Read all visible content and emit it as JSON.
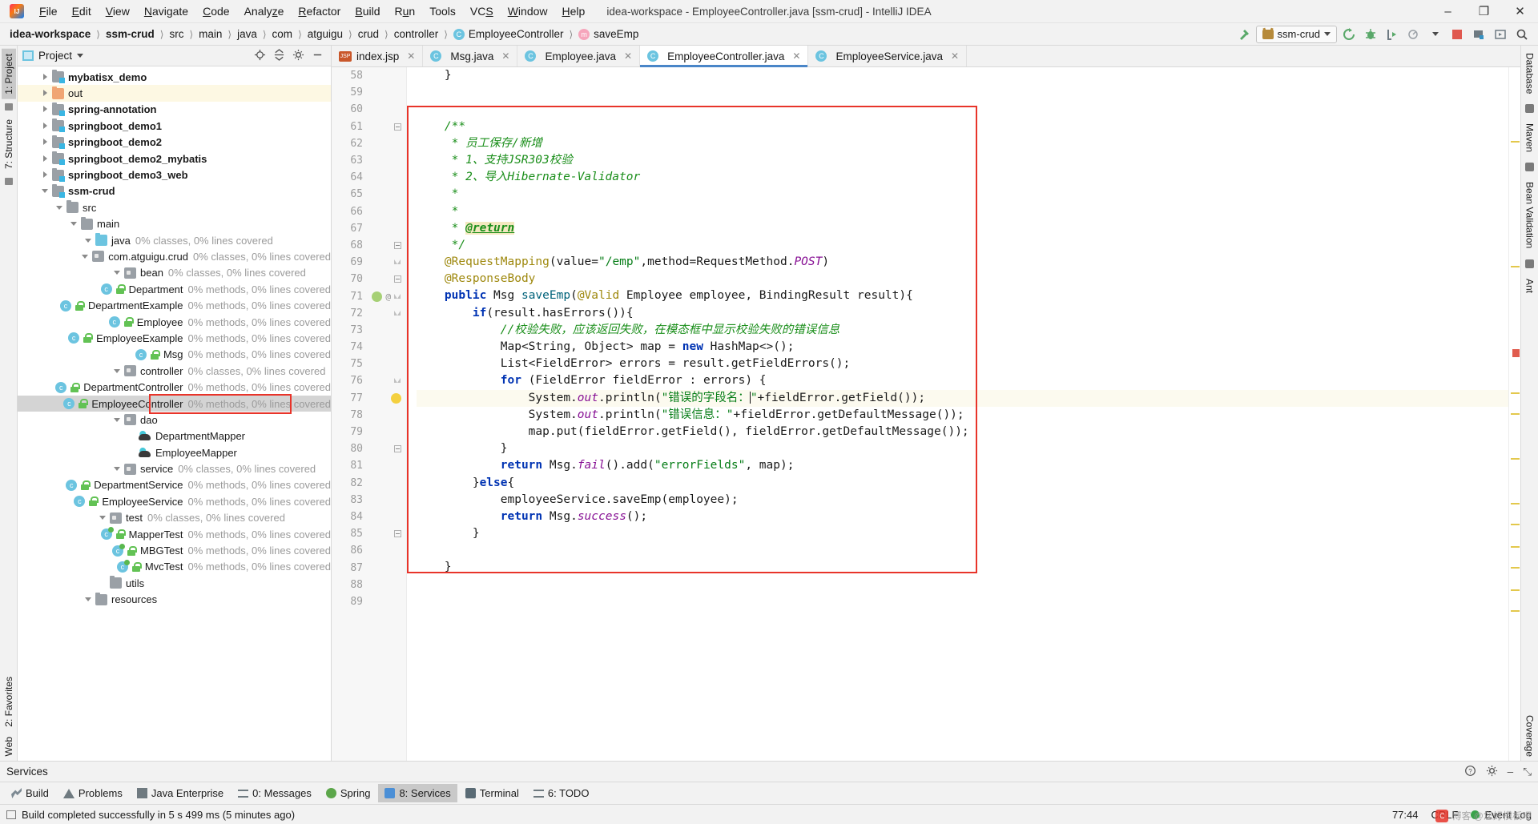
{
  "window": {
    "title": "idea-workspace - EmployeeController.java [ssm-crud] - IntelliJ IDEA",
    "minimize": "–",
    "maximize": "❐",
    "close": "✕"
  },
  "menu": {
    "items": [
      "File",
      "Edit",
      "View",
      "Navigate",
      "Code",
      "Analyze",
      "Refactor",
      "Build",
      "Run",
      "Tools",
      "VCS",
      "Window",
      "Help"
    ]
  },
  "breadcrumb": {
    "items": [
      {
        "label": "idea-workspace",
        "bold": true,
        "icon": ""
      },
      {
        "label": "ssm-crud",
        "bold": true,
        "icon": ""
      },
      {
        "label": "src",
        "bold": false,
        "icon": ""
      },
      {
        "label": "main",
        "bold": false,
        "icon": ""
      },
      {
        "label": "java",
        "bold": false,
        "icon": ""
      },
      {
        "label": "com",
        "bold": false,
        "icon": ""
      },
      {
        "label": "atguigu",
        "bold": false,
        "icon": ""
      },
      {
        "label": "crud",
        "bold": false,
        "icon": ""
      },
      {
        "label": "controller",
        "bold": false,
        "icon": ""
      },
      {
        "label": "EmployeeController",
        "bold": false,
        "icon": "class-badge"
      },
      {
        "label": "saveEmp",
        "bold": false,
        "icon": "method-badge"
      }
    ],
    "separator": "〉"
  },
  "toolbar": {
    "run_config": "ssm-crud",
    "icons": [
      "build-hammer-icon",
      "rerun-icon",
      "debug-icon",
      "run-with-coverage-icon",
      "profiler-icon",
      "stop-icon",
      "open-project-structure-icon",
      "select-in-icon",
      "search-everywhere-icon"
    ]
  },
  "left_rail": {
    "tabs": [
      {
        "label": "1: Project",
        "active": true
      },
      {
        "label": "7: Structure",
        "active": false
      }
    ],
    "bottom_tabs": [
      {
        "label": "2: Favorites",
        "active": false
      },
      {
        "label": "Web",
        "active": false
      }
    ]
  },
  "right_rail": {
    "tabs": [
      "Database",
      "Maven",
      "Bean Validation",
      "Ant",
      "Coverage"
    ]
  },
  "project_panel": {
    "title": "Project",
    "dropdown_caret": "▾",
    "header_icons": [
      "locate-icon",
      "collapse-all-icon",
      "settings-icon",
      "hide-icon"
    ],
    "tree": [
      {
        "depth": 1,
        "arrow": "closed",
        "icon": "module-folder",
        "label": "mybatisx_demo",
        "bold": true,
        "coverage": "",
        "state": ""
      },
      {
        "depth": 1,
        "arrow": "closed",
        "icon": "orange-folder",
        "label": "out",
        "bold": false,
        "coverage": "",
        "state": "hl-yellow"
      },
      {
        "depth": 1,
        "arrow": "closed",
        "icon": "module-folder",
        "label": "spring-annotation",
        "bold": true,
        "coverage": "",
        "state": ""
      },
      {
        "depth": 1,
        "arrow": "closed",
        "icon": "module-folder",
        "label": "springboot_demo1",
        "bold": true,
        "coverage": "",
        "state": ""
      },
      {
        "depth": 1,
        "arrow": "closed",
        "icon": "module-folder",
        "label": "springboot_demo2",
        "bold": true,
        "coverage": "",
        "state": ""
      },
      {
        "depth": 1,
        "arrow": "closed",
        "icon": "module-folder",
        "label": "springboot_demo2_mybatis",
        "bold": true,
        "coverage": "",
        "state": ""
      },
      {
        "depth": 1,
        "arrow": "closed",
        "icon": "module-folder",
        "label": "springboot_demo3_web",
        "bold": true,
        "coverage": "",
        "state": ""
      },
      {
        "depth": 1,
        "arrow": "open",
        "icon": "module-folder",
        "label": "ssm-crud",
        "bold": true,
        "coverage": "",
        "state": ""
      },
      {
        "depth": 2,
        "arrow": "open",
        "icon": "folder",
        "label": "src",
        "bold": false,
        "coverage": "",
        "state": ""
      },
      {
        "depth": 3,
        "arrow": "open",
        "icon": "folder",
        "label": "main",
        "bold": false,
        "coverage": "",
        "state": ""
      },
      {
        "depth": 4,
        "arrow": "open",
        "icon": "blue-folder",
        "label": "java",
        "bold": false,
        "coverage": "0% classes, 0% lines covered",
        "state": ""
      },
      {
        "depth": 5,
        "arrow": "open",
        "icon": "package",
        "label": "com.atguigu.crud",
        "bold": false,
        "coverage": "0% classes, 0% lines covered",
        "state": ""
      },
      {
        "depth": 6,
        "arrow": "open",
        "icon": "package",
        "label": "bean",
        "bold": false,
        "coverage": "0% classes, 0% lines covered",
        "state": ""
      },
      {
        "depth": 7,
        "arrow": "none",
        "icon": "class",
        "label": "Department",
        "bold": false,
        "coverage": "0% methods, 0% lines covered",
        "state": ""
      },
      {
        "depth": 7,
        "arrow": "none",
        "icon": "class",
        "label": "DepartmentExample",
        "bold": false,
        "coverage": "0% methods, 0% lines covered",
        "state": ""
      },
      {
        "depth": 7,
        "arrow": "none",
        "icon": "class",
        "label": "Employee",
        "bold": false,
        "coverage": "0% methods, 0% lines covered",
        "state": ""
      },
      {
        "depth": 7,
        "arrow": "none",
        "icon": "class",
        "label": "EmployeeExample",
        "bold": false,
        "coverage": "0% methods, 0% lines covered",
        "state": ""
      },
      {
        "depth": 7,
        "arrow": "none",
        "icon": "class",
        "label": "Msg",
        "bold": false,
        "coverage": "0% methods, 0% lines covered",
        "state": ""
      },
      {
        "depth": 6,
        "arrow": "open",
        "icon": "package",
        "label": "controller",
        "bold": false,
        "coverage": "0% classes, 0% lines covered",
        "state": ""
      },
      {
        "depth": 7,
        "arrow": "none",
        "icon": "class",
        "label": "DepartmentController",
        "bold": false,
        "coverage": "0% methods, 0% lines covered",
        "state": ""
      },
      {
        "depth": 7,
        "arrow": "none",
        "icon": "class",
        "label": "EmployeeController",
        "bold": false,
        "coverage": "0% methods, 0% lines covered",
        "state": "selected"
      },
      {
        "depth": 6,
        "arrow": "open",
        "icon": "package",
        "label": "dao",
        "bold": false,
        "coverage": "",
        "state": ""
      },
      {
        "depth": 7,
        "arrow": "none",
        "icon": "mapper",
        "label": "DepartmentMapper",
        "bold": false,
        "coverage": "",
        "state": ""
      },
      {
        "depth": 7,
        "arrow": "none",
        "icon": "mapper",
        "label": "EmployeeMapper",
        "bold": false,
        "coverage": "",
        "state": ""
      },
      {
        "depth": 6,
        "arrow": "open",
        "icon": "package",
        "label": "service",
        "bold": false,
        "coverage": "0% classes, 0% lines covered",
        "state": ""
      },
      {
        "depth": 7,
        "arrow": "none",
        "icon": "class",
        "label": "DepartmentService",
        "bold": false,
        "coverage": "0% methods, 0% lines covered",
        "state": ""
      },
      {
        "depth": 7,
        "arrow": "none",
        "icon": "class",
        "label": "EmployeeService",
        "bold": false,
        "coverage": "0% methods, 0% lines covered",
        "state": ""
      },
      {
        "depth": 5,
        "arrow": "open",
        "icon": "package",
        "label": "test",
        "bold": false,
        "coverage": "0% classes, 0% lines covered",
        "state": ""
      },
      {
        "depth": 6,
        "arrow": "none",
        "icon": "test-class",
        "label": "MapperTest",
        "bold": false,
        "coverage": "0% methods, 0% lines covered",
        "state": ""
      },
      {
        "depth": 6,
        "arrow": "none",
        "icon": "test-class",
        "label": "MBGTest",
        "bold": false,
        "coverage": "0% methods, 0% lines covered",
        "state": ""
      },
      {
        "depth": 6,
        "arrow": "none",
        "icon": "test-class",
        "label": "MvcTest",
        "bold": false,
        "coverage": "0% methods, 0% lines covered",
        "state": ""
      },
      {
        "depth": 5,
        "arrow": "none",
        "icon": "folder",
        "label": "utils",
        "bold": false,
        "coverage": "",
        "state": ""
      },
      {
        "depth": 4,
        "arrow": "open",
        "icon": "folder",
        "label": "resources",
        "bold": false,
        "coverage": "",
        "state": ""
      }
    ]
  },
  "editor": {
    "tabs": [
      {
        "label": "index.jsp",
        "icon": "jsp-icon",
        "active": false
      },
      {
        "label": "Msg.java",
        "icon": "class-icon",
        "active": false
      },
      {
        "label": "Employee.java",
        "icon": "class-icon",
        "active": false
      },
      {
        "label": "EmployeeController.java",
        "icon": "class-icon",
        "active": true
      },
      {
        "label": "EmployeeService.java",
        "icon": "class-icon",
        "active": false
      }
    ],
    "first_line_number": 58,
    "lines": [
      {
        "n": 58,
        "html": "    }"
      },
      {
        "n": 59,
        "html": ""
      },
      {
        "n": 60,
        "html": ""
      },
      {
        "n": 61,
        "html": "    <span class='cm'>/**</span>"
      },
      {
        "n": 62,
        "html": "     <span class='cm'>* 员工保存/新增</span>"
      },
      {
        "n": 63,
        "html": "     <span class='cm'>* 1、支持JSR303校验</span>"
      },
      {
        "n": 64,
        "html": "     <span class='cm'>* 2、导入Hibernate-Validator</span>"
      },
      {
        "n": 65,
        "html": "     <span class='cm'>*</span>"
      },
      {
        "n": 66,
        "html": "     <span class='cm'>*</span>"
      },
      {
        "n": 67,
        "html": "     <span class='cm'>* </span><span class='hl-return'>@return</span>"
      },
      {
        "n": 68,
        "html": "     <span class='cm'>*/</span>"
      },
      {
        "n": 69,
        "html": "    <span class='an'>@RequestMapping</span>(value=<span class='str'>\"/emp\"</span>,method=RequestMethod.<span class='stat'>POST</span>)"
      },
      {
        "n": 70,
        "html": "    <span class='an'>@ResponseBody</span>"
      },
      {
        "n": 71,
        "html": "    <span class='k'>public</span> Msg <span class='mtd'>saveEmp</span>(<span class='an'>@Valid</span> Employee employee, BindingResult result){"
      },
      {
        "n": 72,
        "html": "        <span class='k'>if</span>(result.hasErrors()){"
      },
      {
        "n": 73,
        "html": "            <span class='cm'>//校验失败，应该返回失败，在模态框中显示校验失败的错误信息</span>"
      },
      {
        "n": 74,
        "html": "            Map&lt;String, Object&gt; map = <span class='k'>new</span> HashMap&lt;&gt;();"
      },
      {
        "n": 75,
        "html": "            List&lt;FieldError&gt; errors = result.getFieldErrors();"
      },
      {
        "n": 76,
        "html": "            <span class='k'>for</span> (FieldError fieldError : errors) {"
      },
      {
        "n": 77,
        "html": "                System.<span class='fld'>out</span>.println(<span class='str'>\"错误的字段名：</span><span class='caret-bar'></span><span class='str'>\"</span>+fieldError.getField());"
      },
      {
        "n": 78,
        "html": "                System.<span class='fld'>out</span>.println(<span class='str'>\"错误信息：\"</span>+fieldError.getDefaultMessage());"
      },
      {
        "n": 79,
        "html": "                map.put(fieldError.getField(), fieldError.getDefaultMessage());"
      },
      {
        "n": 80,
        "html": "            }"
      },
      {
        "n": 81,
        "html": "            <span class='k'>return</span> Msg.<span class='stat'>fail</span>().add(<span class='str'>\"errorFields\"</span>, map);"
      },
      {
        "n": 82,
        "html": "        }<span class='k'>else</span>{"
      },
      {
        "n": 83,
        "html": "            employeeService.saveEmp(employee);"
      },
      {
        "n": 84,
        "html": "            <span class='k'>return</span> Msg.<span class='stat'>success</span>();"
      },
      {
        "n": 85,
        "html": "        }"
      },
      {
        "n": 86,
        "html": ""
      },
      {
        "n": 87,
        "html": "    }"
      },
      {
        "n": 88,
        "html": ""
      },
      {
        "n": 89,
        "html": ""
      }
    ],
    "cursor_line": 77
  },
  "services_panel": {
    "title": "Services",
    "icons": [
      "help-icon",
      "settings-icon",
      "minimize-icon",
      "hide-icon"
    ],
    "minimize": "–",
    "hide": "⤡"
  },
  "tool_windows": [
    {
      "label": "Build",
      "icon": "build-icon",
      "active": false
    },
    {
      "label": "Problems",
      "icon": "warning-icon",
      "active": false
    },
    {
      "label": "Java Enterprise",
      "icon": "java-enterprise-icon",
      "active": false
    },
    {
      "label": "0: Messages",
      "icon": "messages-icon",
      "active": false
    },
    {
      "label": "Spring",
      "icon": "spring-icon",
      "active": false
    },
    {
      "label": "8: Services",
      "icon": "services-icon",
      "active": true
    },
    {
      "label": "Terminal",
      "icon": "terminal-icon",
      "active": false
    },
    {
      "label": "6: TODO",
      "icon": "todo-icon",
      "active": false
    }
  ],
  "statusbar": {
    "message": "Build completed successfully in 5 s 499 ms (5 minutes ago)",
    "caret_position": "77:44",
    "line_separator": "CRLF",
    "event_log": "Event Log"
  },
  "watermark": {
    "text": "博客 @您好模板吧"
  },
  "colors": {
    "accent_blue": "#4a86c8",
    "selection_red": "#e8342a",
    "comment_green": "#1a8e1a",
    "string_green": "#067d17",
    "keyword_blue": "#0033b3",
    "annotation_gold": "#9e880d",
    "static_purple": "#871094",
    "coverage_gray": "#9b9b9b",
    "tree_selected": "#d4d4d4"
  }
}
